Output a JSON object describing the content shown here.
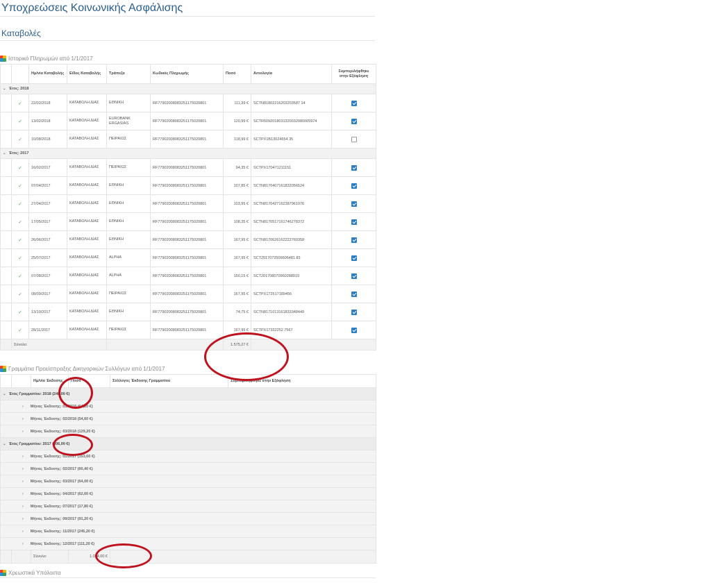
{
  "page_title": "Υποχρεώσεις Κοινωνικής Ασφάλισης",
  "subtitle": "Καταβολές",
  "payments": {
    "title": "Ιστορικό Πληρωμών από 1/1/2017",
    "headers": [
      "Ημ/νία Καταβολής",
      "Είδος Καταβολής",
      "Τράπεζα",
      "Κωδικός Πληρωμής",
      "Ποσό",
      "Αιτιολογία",
      "Συμπεριλήφθηκε στην Εξόφληση"
    ],
    "group_2018": "Έτος: 2018",
    "group_2017": "Έτος: 2017",
    "rows_2018": [
      {
        "date": "22/02/2018",
        "type": "ΚΑΤΑΒΟΛΗ ΔΙΑΣ",
        "bank": "ΕΘΝΙΚΗ",
        "code": "RF77902008083251175020801",
        "amount": "111,39 €",
        "reason": "SCTN81802216203203587 14",
        "checked": true
      },
      {
        "date": "13/02/2018",
        "type": "ΚΑΤΑΒΟΛΗ ΔΙΑΣ",
        "bank": "EUROBANK ERGASIAS",
        "code": "RF77902008083251175020801",
        "amount": "120,99 €",
        "reason": "SCTR5092018031320032080005974",
        "checked": true
      },
      {
        "date": "10/08/2018",
        "type": "ΚΑΤΑΒΟΛΗ ΔΙΑΣ",
        "bank": "ΠΕΙΡΑΙΩΣ",
        "code": "RF77902008083251175020801",
        "amount": "118,99 €",
        "reason": "SCTPX1B13024654 35",
        "checked": false
      }
    ],
    "rows_2017": [
      {
        "date": "16/02/2017",
        "type": "ΚΑΤΑΒΟΛΗ ΔΙΑΣ",
        "bank": "ΠΕΙΡΑΙΩΣ",
        "code": "RF77902008083251175020801",
        "amount": "94,35 €",
        "reason": "SCTPX170471211151",
        "checked": true
      },
      {
        "date": "07/04/2017",
        "type": "ΚΑΤΑΒΟΛΗ ΔΙΑΣ",
        "bank": "ΕΘΝΙΚΗ",
        "code": "RF77902008083251175020801",
        "amount": "107,85 €",
        "reason": "SCTN8170407161833356524",
        "checked": true
      },
      {
        "date": "27/04/2017",
        "type": "ΚΑΤΑΒΟΛΗ ΔΙΑΣ",
        "bank": "ΕΘΝΙΚΗ",
        "code": "RF77902008083251175020801",
        "amount": "103,95 €",
        "reason": "SCTN8170427162387961976",
        "checked": true
      },
      {
        "date": "17/05/2017",
        "type": "ΚΑΤΑΒΟΛΗ ΔΙΑΣ",
        "bank": "ΕΘΝΙΚΗ",
        "code": "RF77902008083251175020801",
        "amount": "108,35 €",
        "reason": "SCTN8170517161746278372",
        "checked": true
      },
      {
        "date": "26/06/2017",
        "type": "ΚΑΤΑΒΟΛΗ ΔΙΑΣ",
        "bank": "ΕΘΝΙΚΗ",
        "code": "RF77902008083251175020801",
        "amount": "167,95 €",
        "reason": "SCTN8170626162223760358",
        "checked": true
      },
      {
        "date": "25/07/2017",
        "type": "ΚΑΤΑΒΟΛΗ ΔΙΑΣ",
        "bank": "ALPHA",
        "code": "RF77902008083251175020801",
        "amount": "167,95 €",
        "reason": "SCT2017072509606481 83",
        "checked": true
      },
      {
        "date": "07/08/2017",
        "type": "ΚΑΤΑΒΟΛΗ ΔΙΑΣ",
        "bank": "ALPHA",
        "code": "RF77902008083251175020801",
        "amount": "150,15 €",
        "reason": "SCT201708070960288919",
        "checked": true
      },
      {
        "date": "08/09/2017",
        "type": "ΚΑΤΑΒΟΛΗ ΔΙΑΣ",
        "bank": "ΠΕΙΡΑΙΩΣ",
        "code": "RF77902008083251175020801",
        "amount": "167,95 €",
        "reason": "SCTPX172517189456",
        "checked": true
      },
      {
        "date": "13/10/2017",
        "type": "ΚΑΤΑΒΟΛΗ ΔΙΑΣ",
        "bank": "ΕΘΝΙΚΗ",
        "code": "RF77902008083251175020801",
        "amount": "74,75 €",
        "reason": "SCTN8171013161833348449",
        "checked": true
      },
      {
        "date": "28/11/2017",
        "type": "ΚΑΤΑΒΟΛΗ ΔΙΑΣ",
        "bank": "ΠΕΙΡΑΙΩΣ",
        "code": "RF77902008083251175020801",
        "amount": "167,95 €",
        "reason": "SCTPX17332252 7567",
        "checked": true
      }
    ],
    "total_label": "Σύνολο:",
    "total_value": "1.575,27 €"
  },
  "notes": {
    "title": "Γραμμάτια Προείσπραξης Δικηγορικών Συλλόγων από 1/1/2017",
    "headers": [
      "Ημ/νία Έκδοσης",
      "Ποσό",
      "Σύλλογος Έκδοσης Γραμματίου",
      "Συμπεριλήφθηκε στην Εξόφληση"
    ],
    "year_2018": "Έτος Γραμματίου: 2018 (248,00 €)",
    "months_2018": [
      "Μήνας Έκδοσης: 01/2018 (64,20 €)",
      "Μήνας Έκδοσης: 02/2018 (54,60 €)",
      "Μήνας Έκδοσης: 03/2018 (129,20 €)"
    ],
    "year_2017": "Έτος Γραμματίου: 2017 (806,00 €)",
    "months_2017": [
      "Μήνας Έκδοσης: 01/2017 (153,60 €)",
      "Μήνας Έκδοσης: 02/2017 (60,40 €)",
      "Μήνας Έκδοσης: 03/2017 (64,00 €)",
      "Μήνας Έκδοσης: 04/2017 (62,60 €)",
      "Μήνας Έκδοσης: 07/2017 (17,80 €)",
      "Μήνας Έκδοσης: 09/2017 (91,20 €)",
      "Μήνας Έκδοσης: 11/2017 (245,20 €)",
      "Μήνας Έκδοσης: 12/2017 (111,20 €)"
    ],
    "total_label": "Σύνολο:",
    "total_value": "1.054,00 €"
  },
  "debts": {
    "title": "Χρεωστικά Υπόλοιπα"
  },
  "icons": {
    "section": "cube-icon",
    "expand": "chevron-right-icon",
    "collapse": "chevron-down-icon",
    "paid": "check-icon"
  },
  "colors": {
    "title": "#2a5d8e",
    "annotation": "#c0121e",
    "checkbox": "#2e7fc1"
  }
}
